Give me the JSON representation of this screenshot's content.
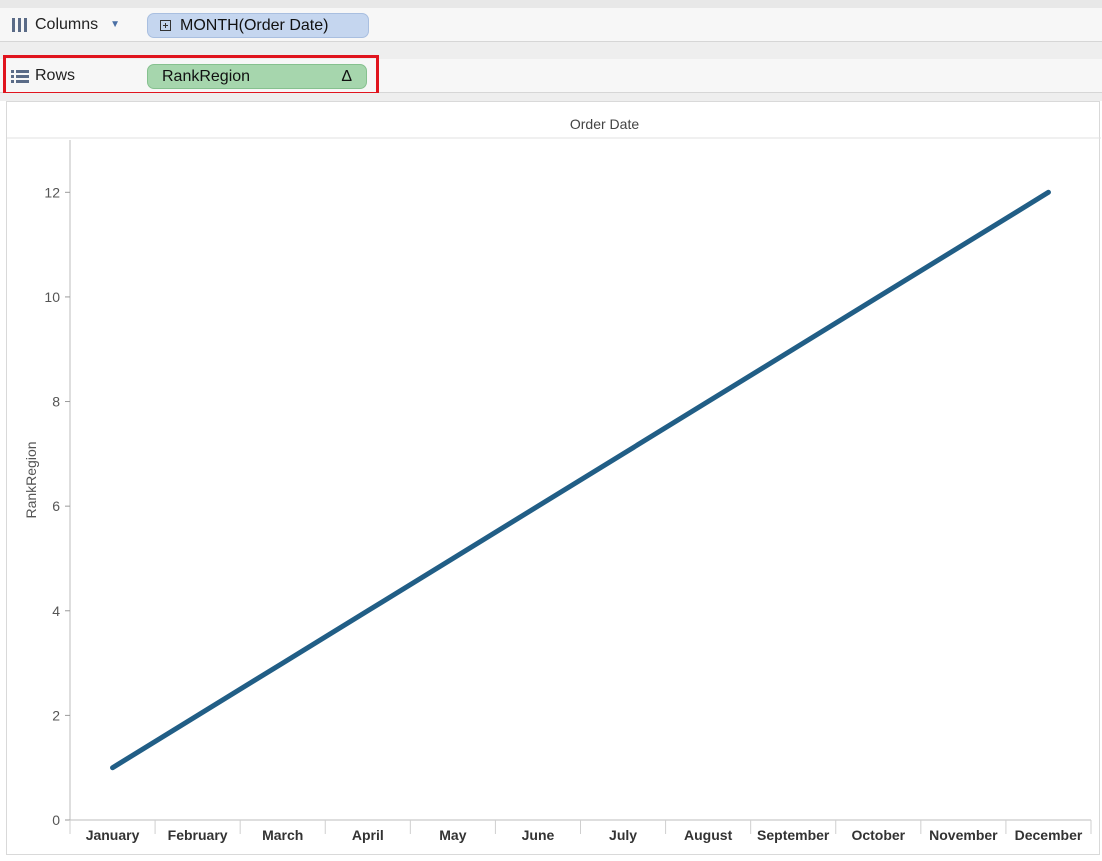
{
  "shelves": {
    "columns": {
      "label": "Columns",
      "pill_label": "MONTH(Order Date)"
    },
    "rows": {
      "label": "Rows",
      "pill_label": "RankRegion",
      "pill_badge": "Δ"
    }
  },
  "colors": {
    "columns_pill": "#c5d6ef",
    "rows_pill": "#a6d6ad",
    "highlight": "#e0141e",
    "line": "#215e86"
  },
  "chart_data": {
    "type": "line",
    "title": "Order Date",
    "xlabel": "",
    "ylabel": "RankRegion",
    "categories": [
      "January",
      "February",
      "March",
      "April",
      "May",
      "June",
      "July",
      "August",
      "September",
      "October",
      "November",
      "December"
    ],
    "series": [
      {
        "values": [
          1,
          2,
          3,
          4,
          5,
          6,
          7,
          8,
          9,
          10,
          11,
          12
        ]
      }
    ],
    "ylim": [
      0,
      13
    ],
    "yticks": [
      0,
      2,
      4,
      6,
      8,
      10,
      12
    ],
    "grid": false,
    "legend": "none"
  }
}
